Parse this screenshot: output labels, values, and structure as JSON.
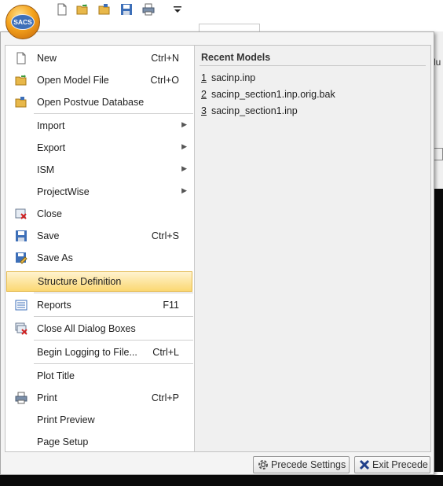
{
  "app": {
    "logo_text": "SACS"
  },
  "background": {
    "right_panel_text": "lu"
  },
  "menu": {
    "items": [
      {
        "label": "New",
        "shortcut": "Ctrl+N",
        "icon": "new-file-icon"
      },
      {
        "label": "Open Model File",
        "shortcut": "Ctrl+O",
        "icon": "open-folder-icon"
      },
      {
        "label": "Open Postvue Database",
        "shortcut": "",
        "icon": "open-database-icon"
      },
      {
        "label": "Import",
        "shortcut": "",
        "icon": ""
      },
      {
        "label": "Export",
        "shortcut": "",
        "icon": ""
      },
      {
        "label": "ISM",
        "shortcut": "",
        "icon": ""
      },
      {
        "label": "ProjectWise",
        "shortcut": "",
        "icon": ""
      },
      {
        "label": "Close",
        "shortcut": "",
        "icon": "close-file-icon"
      },
      {
        "label": "Save",
        "shortcut": "Ctrl+S",
        "icon": "save-icon"
      },
      {
        "label": "Save As",
        "shortcut": "",
        "icon": "save-as-icon"
      },
      {
        "label": "Structure Definition",
        "shortcut": "",
        "icon": ""
      },
      {
        "label": "Reports",
        "shortcut": "F11",
        "icon": "reports-icon"
      },
      {
        "label": "Close All Dialog Boxes",
        "shortcut": "",
        "icon": "close-dialogs-icon"
      },
      {
        "label": "Begin Logging to File...",
        "shortcut": "Ctrl+L",
        "icon": ""
      },
      {
        "label": "Plot Title",
        "shortcut": "",
        "icon": ""
      },
      {
        "label": "Print",
        "shortcut": "Ctrl+P",
        "icon": "printer-icon"
      },
      {
        "label": "Print Preview",
        "shortcut": "",
        "icon": ""
      },
      {
        "label": "Page Setup",
        "shortcut": "",
        "icon": ""
      }
    ],
    "recent": {
      "title": "Recent Models",
      "files": [
        {
          "num": "1",
          "name": "sacinp.inp"
        },
        {
          "num": "2",
          "name": "sacinp_section1.inp.orig.bak"
        },
        {
          "num": "3",
          "name": "sacinp_section1.inp"
        }
      ]
    },
    "buttons": {
      "settings": "Precede Settings",
      "exit": "Exit Precede"
    }
  },
  "colors": {
    "highlight": "#fbd872",
    "menu_background": "#f0f0f0",
    "exit_icon": "#1f3f8a"
  }
}
